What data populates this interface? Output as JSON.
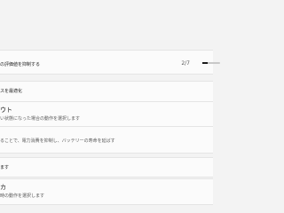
{
  "settings": [
    {
      "label": "の評価値を抑制する",
      "value": "2/7",
      "slider_fraction": 0.29
    },
    {
      "label": "スを最適化"
    },
    {
      "title": "ウト",
      "description": "い状態になった場合の動作を選択します"
    },
    {
      "description": "ることで、電力消費を抑制し、バッテリーの寿命を延ばす"
    },
    {
      "label": "ます"
    },
    {
      "title": "カ",
      "description": "時の動作を選択します"
    }
  ]
}
